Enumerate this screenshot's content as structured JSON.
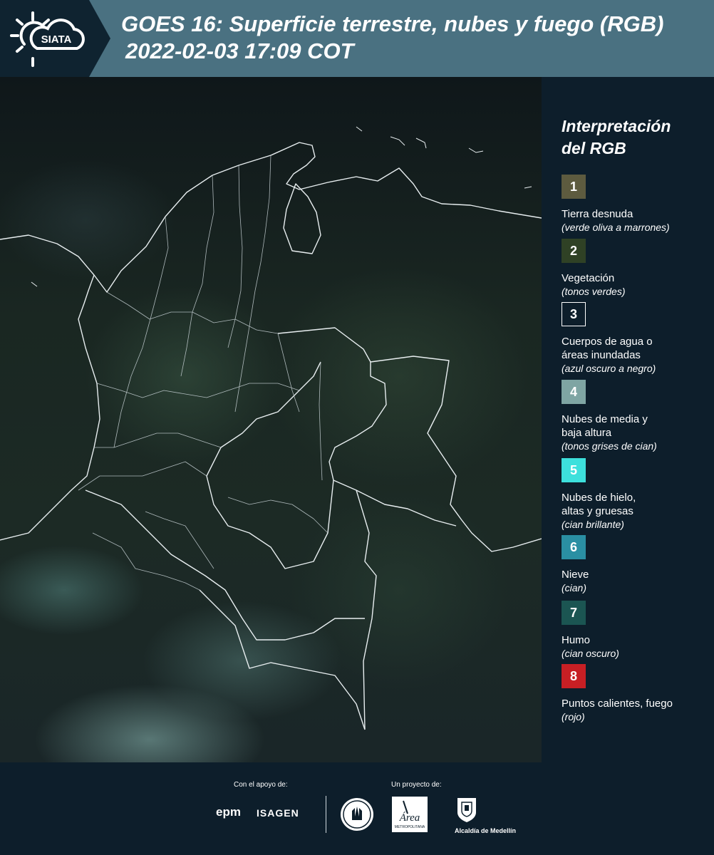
{
  "header": {
    "logo_text": "SIATA",
    "title_line1": "GOES 16: Superficie terrestre, nubes y fuego (RGB)",
    "title_line2": "2022-02-03 17:09 COT"
  },
  "legend": {
    "title_line1": "Interpretación",
    "title_line2": "del RGB",
    "items": [
      {
        "number": "1",
        "color": "#5d5b3f",
        "label_lines": [
          "Tierra desnuda"
        ],
        "sub": "(verde oliva a marrones)"
      },
      {
        "number": "2",
        "color": "#2f4125",
        "label_lines": [
          "Vegetación"
        ],
        "sub": "(tonos verdes)"
      },
      {
        "number": "3",
        "color": "#0d1e2b",
        "label_lines": [
          "Cuerpos de agua o",
          "áreas inundadas"
        ],
        "sub": "(azul oscuro a negro)"
      },
      {
        "number": "4",
        "color": "#7fa5a3",
        "label_lines": [
          "Nubes de media y",
          "baja altura"
        ],
        "sub": "(tonos grises de cian)"
      },
      {
        "number": "5",
        "color": "#3de0dc",
        "label_lines": [
          "Nubes de hielo,",
          "altas y gruesas"
        ],
        "sub": "(cian brillante)"
      },
      {
        "number": "6",
        "color": "#2a8fa3",
        "label_lines": [
          "Nieve"
        ],
        "sub": "(cian)"
      },
      {
        "number": "7",
        "color": "#1b5552",
        "label_lines": [
          "Humo"
        ],
        "sub": "(cian oscuro)"
      },
      {
        "number": "8",
        "color": "#c71f24",
        "label_lines": [
          "Puntos calientes, fuego"
        ],
        "sub": "(rojo)"
      }
    ]
  },
  "footer": {
    "support_caption": "Con el apoyo de:",
    "project_caption": "Un proyecto de:",
    "sponsor_epm": "epm",
    "sponsor_isagen": "ISAGEN",
    "area_logo_text": "Área",
    "area_logo_sub": "METROPOLITANA",
    "alcaldia": "Alcaldía de Medellín"
  }
}
